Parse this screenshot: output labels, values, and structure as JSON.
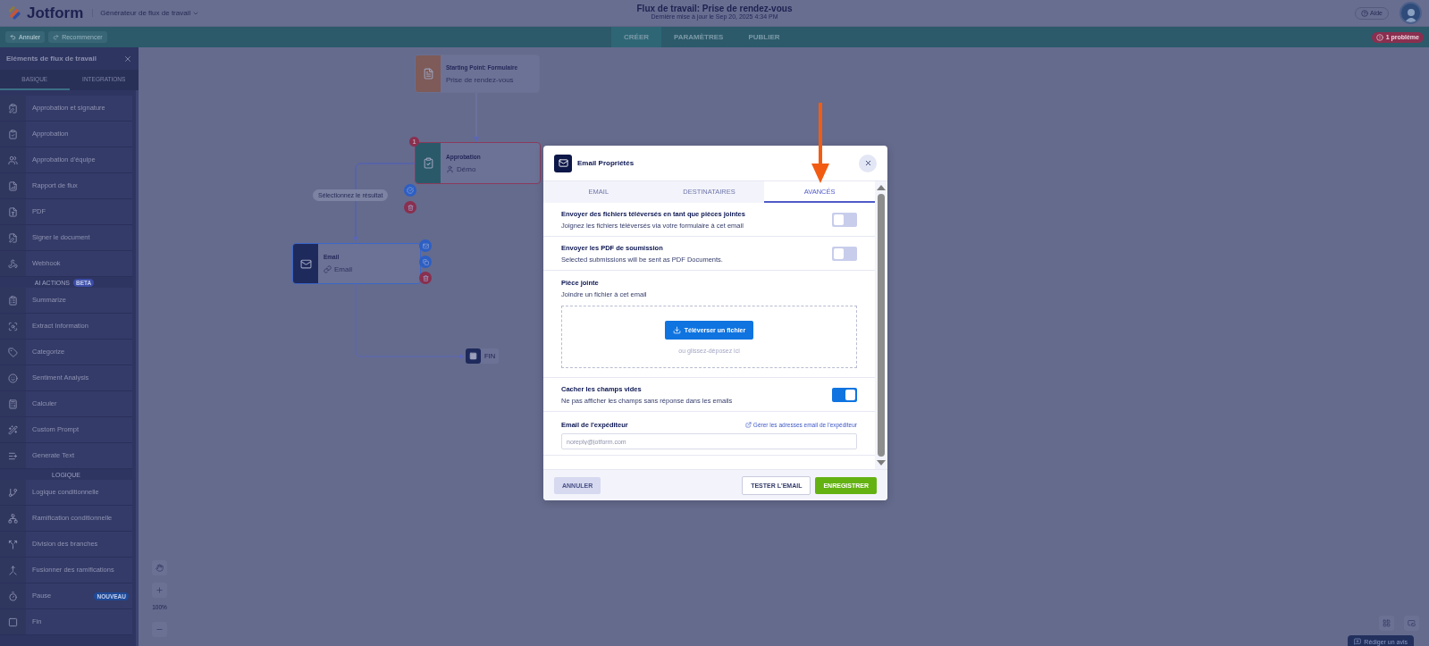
{
  "header": {
    "logo": "Jotform",
    "builder": "Générateur de flux de travail",
    "title": "Flux de travail: Prise de rendez-vous",
    "subtitle": "Dernière mise à jour le Sep 20, 2025 4:34 PM",
    "help": "Aide"
  },
  "toolbar": {
    "buttons": [
      {
        "label": "Annuler",
        "disabled": false
      },
      {
        "label": "Recommencer",
        "disabled": true
      }
    ],
    "nav_tabs": [
      {
        "label": "CRÉER",
        "selected": true
      },
      {
        "label": "PARAMÈTRES",
        "selected": false
      },
      {
        "label": "PUBLIER",
        "selected": false
      }
    ],
    "issues": "1 problème"
  },
  "sidebar": {
    "title": "Eléments de flux de travail",
    "tabs": [
      {
        "label": "BASIQUE",
        "selected": true
      },
      {
        "label": "INTEGRATIONS",
        "selected": false
      }
    ],
    "sections": [
      {
        "items": [
          {
            "label": "Approbation et signature"
          },
          {
            "label": "Approbation"
          },
          {
            "label": "Approbation d'équipe"
          },
          {
            "label": "Rapport de flux"
          },
          {
            "label": "PDF"
          },
          {
            "label": "Signer le document"
          },
          {
            "label": "Webhook"
          }
        ]
      },
      {
        "title": "AI ACTIONS",
        "badge": "BETA",
        "items": [
          {
            "label": "Summarize"
          },
          {
            "label": "Extract Information"
          },
          {
            "label": "Categorize"
          },
          {
            "label": "Sentiment Analysis"
          },
          {
            "label": "Calculer"
          },
          {
            "label": "Custom Prompt"
          },
          {
            "label": "Generate Text"
          }
        ]
      },
      {
        "title": "LOGIQUE",
        "items": [
          {
            "label": "Logique conditionnelle"
          },
          {
            "label": "Ramification conditionnelle"
          },
          {
            "label": "Division des branches"
          },
          {
            "label": "Fusionner des ramifications"
          },
          {
            "label": "Pause",
            "badge": "NOUVEAU"
          },
          {
            "label": "Fin"
          }
        ]
      }
    ]
  },
  "canvas": {
    "nodes": [
      {
        "kind": "start",
        "label": "Starting Point: Formulaire",
        "value": "Prise de rendez-vous",
        "selected": false
      },
      {
        "kind": "approval",
        "label": "Approbation",
        "value": "Démo",
        "issue_count": "1",
        "selected": false
      },
      {
        "kind": "email",
        "label": "Email",
        "value": "Email",
        "selected": true
      },
      {
        "kind": "end",
        "label": "FIN",
        "selected": false
      }
    ],
    "branch_label": "Sélectionnez le résultat",
    "zoom": "100%",
    "feedback": "Rédiger un avis"
  },
  "modal": {
    "title": "Email Propriétés",
    "tabs": [
      {
        "label": "EMAIL",
        "selected": false
      },
      {
        "label": "DESTINATAIRES",
        "selected": false
      },
      {
        "label": "AVANCÉS",
        "selected": true
      }
    ],
    "settings": [
      {
        "kind": "toggle",
        "title": "Envoyer des fichiers téléversés en tant que pièces jointes",
        "description": "Joignez les fichiers téléversés via votre formulaire à cet email",
        "on": false
      },
      {
        "kind": "toggle",
        "title": "Envoyer les PDF de soumission",
        "description": "Selected submissions will be sent as PDF Documents.",
        "on": false
      },
      {
        "kind": "upload",
        "title": "Pièce jointe",
        "description": "Joindre un fichier à cet email",
        "button": "Téléverser un fichier",
        "hint": "ou glissez-déposez ici"
      },
      {
        "kind": "toggle",
        "title": "Cacher les champs vides",
        "description": "Ne pas afficher les champs sans réponse dans les emails",
        "on": true
      },
      {
        "kind": "field",
        "title": "Email de l'expéditeur",
        "link": "Gérer les adresses email de l'expéditeur",
        "placeholder": "noreply@jotform.com"
      }
    ],
    "buttons": {
      "cancel": "ANNULER",
      "test": "TESTER L'EMAIL",
      "save": "ENREGISTRER"
    }
  }
}
